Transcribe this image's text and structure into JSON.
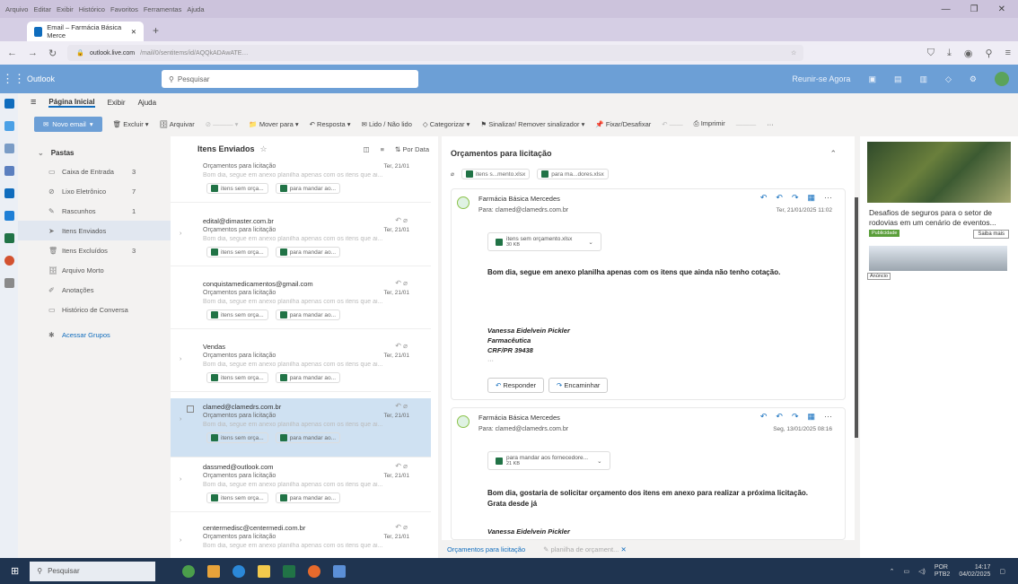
{
  "firefox": {
    "menu": [
      "Arquivo",
      "Editar",
      "Exibir",
      "Histórico",
      "Favoritos",
      "Ferramentas",
      "Ajuda"
    ],
    "tab_title": "Email – Farmácia Básica Merce",
    "url_host": "outlook.live.com",
    "url_path": "/mail/0/sentitems/id/AQQkADAwATE…"
  },
  "outlook": {
    "brand": "Outlook",
    "search_placeholder": "Pesquisar",
    "meet_label": "Reunir-se Agora",
    "ribbon_tabs": [
      "Página Inicial",
      "Exibir",
      "Ajuda"
    ],
    "toolbar": {
      "new_mail": "Novo email",
      "delete": "Excluir",
      "archive": "Arquivar",
      "move_to": "Mover para",
      "reply": "Resposta",
      "read_unread": "Lido / Não lido",
      "categorize": "Categorizar",
      "flag": "Sinalizar/ Remover sinalizador",
      "pin": "Fixar/Desafixar",
      "print": "Imprimir",
      "more": "···"
    }
  },
  "folders": {
    "header": "Pastas",
    "items": [
      {
        "name": "Caixa de Entrada",
        "count": "3",
        "icon": "inbox-icon"
      },
      {
        "name": "Lixo Eletrônico",
        "count": "7",
        "icon": "junk-icon"
      },
      {
        "name": "Rascunhos",
        "count": "1",
        "icon": "drafts-icon"
      },
      {
        "name": "Itens Enviados",
        "count": "",
        "icon": "sent-icon"
      },
      {
        "name": "Itens Excluídos",
        "count": "3",
        "icon": "trash-icon"
      },
      {
        "name": "Arquivo Morto",
        "count": "",
        "icon": "archive-icon"
      },
      {
        "name": "Anotações",
        "count": "",
        "icon": "notes-icon"
      },
      {
        "name": "Histórico de Conversa",
        "count": "",
        "icon": "history-icon"
      }
    ],
    "groups_link": "Acessar Grupos"
  },
  "message_list": {
    "title": "Itens Enviados",
    "sort": "Por Data",
    "messages": [
      {
        "from": "",
        "subject": "Orçamentos para licitação",
        "date": "Ter, 21/01",
        "preview": "Bom dia, segue em anexo planilha apenas com os itens que ai...",
        "chips": [
          "itens sem orça...",
          "para mandar ao..."
        ]
      },
      {
        "from": "edital@dimaster.com.br",
        "subject": "Orçamentos para licitação",
        "date": "Ter, 21/01",
        "preview": "Bom dia, segue em anexo planilha apenas com os itens que ai...",
        "chips": [
          "itens sem orça...",
          "para mandar ao..."
        ]
      },
      {
        "from": "conquistamedicamentos@gmail.com",
        "subject": "Orçamentos para licitação",
        "date": "Ter, 21/01",
        "preview": "Bom dia, segue em anexo planilha apenas com os itens que ai...",
        "chips": [
          "itens sem orça...",
          "para mandar ao..."
        ]
      },
      {
        "from": "Vendas",
        "subject": "Orçamentos para licitação",
        "date": "Ter, 21/01",
        "preview": "Bom dia, segue em anexo planilha apenas com os itens que ai...",
        "chips": [
          "itens sem orça...",
          "para mandar ao..."
        ]
      },
      {
        "from": "clamed@clamedrs.com.br",
        "subject": "Orçamentos para licitação",
        "date": "Ter, 21/01",
        "preview": "Bom dia, segue em anexo planilha apenas com os itens que ai...",
        "chips": [
          "itens sem orça...",
          "para mandar ao..."
        ]
      },
      {
        "from": "dassmed@outlook.com",
        "subject": "Orçamentos para licitação",
        "date": "Ter, 21/01",
        "preview": "Bom dia, segue em anexo planilha apenas com os itens que ai...",
        "chips": [
          "itens sem orça...",
          "para mandar ao..."
        ]
      },
      {
        "from": "centermedisc@centermedi.com.br",
        "subject": "Orçamentos para licitação",
        "date": "Ter, 21/01",
        "preview": "Bom dia, segue em anexo planilha apenas com os itens que ai...",
        "chips": []
      }
    ]
  },
  "reading": {
    "title": "Orçamentos para licitação",
    "thread_attachments": [
      "itens s...mento.xlsx",
      "para ma...dores.xlsx"
    ],
    "email1": {
      "sender": "Farmácia Básica Mercedes",
      "to": "Para: clamed@clamedrs.com.br",
      "date": "Ter, 21/01/2025 11:02",
      "attachment_name": "itens sem orçamento.xlsx",
      "attachment_size": "30 KB",
      "body": "Bom dia, segue em anexo planilha apenas com os itens que ainda não tenho cotação.",
      "sig_name": "Vanessa Eidelvein Pickler",
      "sig_role": "Farmacêutica",
      "sig_crf": "CRF/PR 39438",
      "ellipsis": "···",
      "reply": "Responder",
      "forward": "Encaminhar"
    },
    "email2": {
      "sender": "Farmácia Básica Mercedes",
      "to": "Para: clamed@clamedrs.com.br",
      "date": "Seg, 13/01/2025 08:16",
      "attachment_name": "para mandar aos fornecedore...",
      "attachment_size": "21 KB",
      "body1": "Bom dia, gostaria de solicitar orçamento dos itens em anexo para realizar a próxima licitação.",
      "body2": "Grata desde já",
      "sig_name": "Vanessa Eidelvein Pickler"
    },
    "footer_tab1": "Orçamentos para licitação",
    "footer_tab2": "planilha de orçament..."
  },
  "ad": {
    "title": "Desafios de seguros para o setor de rodovias em um cenário de eventos...",
    "badge": "Publicidade",
    "more": "Saiba mais",
    "anuncio": "Anúncio"
  },
  "taskbar": {
    "search": "Pesquisar",
    "lang": "POR",
    "lang2": "PTB2",
    "time": "14:17",
    "date": "04/02/2025"
  }
}
